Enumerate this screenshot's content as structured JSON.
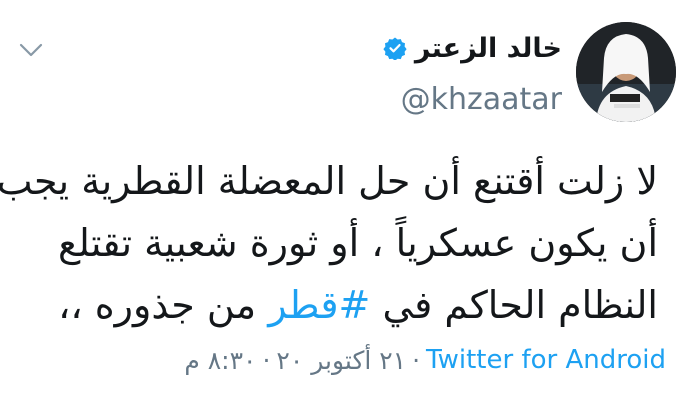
{
  "author": {
    "display_name": "خالد الزعتر",
    "handle": "@khzaatar",
    "verified": true
  },
  "tweet": {
    "line1": "لا زلت أقتنع أن حل المعضلة القطرية يجب",
    "line2": "أن يكون عسكرياً ، أو ثورة شعبية تقتلع",
    "line3_before": "النظام الحاكم في ",
    "hashtag": "#قطر",
    "line3_after": " من جذوره ،،"
  },
  "meta": {
    "time": "٨:٣٠ م",
    "separator": "·",
    "date": "٢١ أكتوبر ٢٠",
    "source": "Twitter for Android"
  },
  "colors": {
    "link": "#1da1f2",
    "secondary_text": "#657786",
    "primary_text": "#14171a"
  },
  "icons": {
    "verified": "verified-badge-icon",
    "caret": "chevron-down-icon"
  }
}
